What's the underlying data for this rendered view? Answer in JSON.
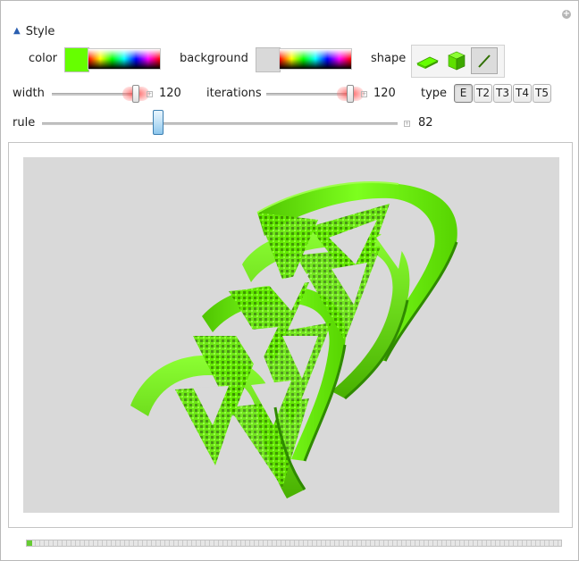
{
  "style_section": {
    "label": "Style",
    "expanded": true
  },
  "controls": {
    "color": {
      "label": "color",
      "value": "#66ff00"
    },
    "background": {
      "label": "background",
      "value": "#d9d9d9"
    },
    "shape": {
      "label": "shape",
      "options": [
        "polygon-shape",
        "cube-shape",
        "line-shape"
      ],
      "selected": "line-shape"
    },
    "width": {
      "label": "width",
      "value": "120",
      "fraction": 0.95
    },
    "iterations": {
      "label": "iterations",
      "value": "120",
      "fraction": 0.95
    },
    "type": {
      "label": "type",
      "options": [
        "E",
        "T2",
        "T3",
        "T4",
        "T5"
      ],
      "selected": "E"
    },
    "rule": {
      "label": "rule",
      "value": "82",
      "fraction": 0.33
    }
  },
  "graphic": {
    "object_color": "#66ff00",
    "background_color": "#d9d9d9"
  },
  "animation_progress": {
    "fraction": 0.01
  }
}
